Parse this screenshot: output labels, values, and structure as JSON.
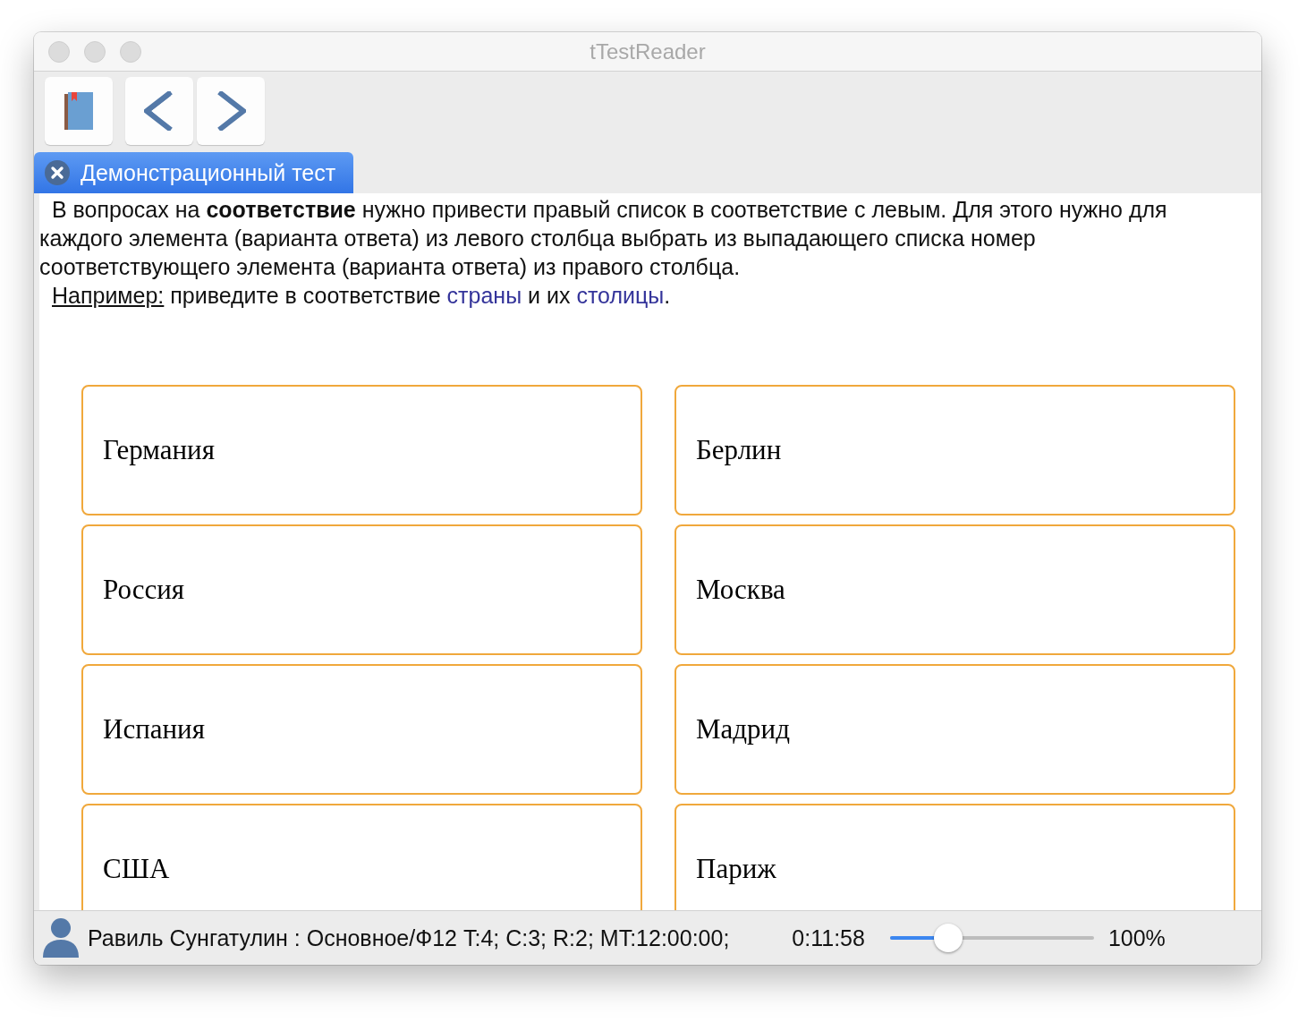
{
  "window": {
    "title": "tTestReader"
  },
  "toolbar": {
    "buttons": [
      {
        "kind": "book"
      },
      {
        "kind": "back"
      },
      {
        "kind": "forward"
      }
    ]
  },
  "tabs": [
    {
      "label": "Демонстрационный тест",
      "selected": true
    }
  ],
  "instructions": {
    "paragraph": "В вопросах на **соответствие** нужно привести правый список в соответствие с левым. Для этого нужно для каждого элемента (варианта ответа) из левого столбца выбрать из выпадающего списка номер соответствующего элемента (варианта ответа) из правого столбца.",
    "example": [
      {
        "kind": "underline",
        "text": "Например:"
      },
      {
        "kind": "plain",
        "text": " приведите в соответствие "
      },
      {
        "kind": "highlight",
        "text": "страны"
      },
      {
        "kind": "plain",
        "text": " и их "
      },
      {
        "kind": "highlight",
        "text": "столицы"
      },
      {
        "kind": "plain",
        "text": "."
      }
    ]
  },
  "pairs": [
    {
      "left": "Германия",
      "right": "Берлин"
    },
    {
      "left": "Россия",
      "right": "Москва"
    },
    {
      "left": "Испания",
      "right": "Мадрид"
    },
    {
      "left": "США",
      "right": "Париж"
    }
  ],
  "status_bar": {
    "user": "Равиль Сунгатулин : Основное/Ф12 T:4; C:3; R:2; MT:12:00:00;",
    "timer": "0:11:58",
    "zoom": {
      "level": 0.285
    },
    "zoom_reading": "100%"
  }
}
